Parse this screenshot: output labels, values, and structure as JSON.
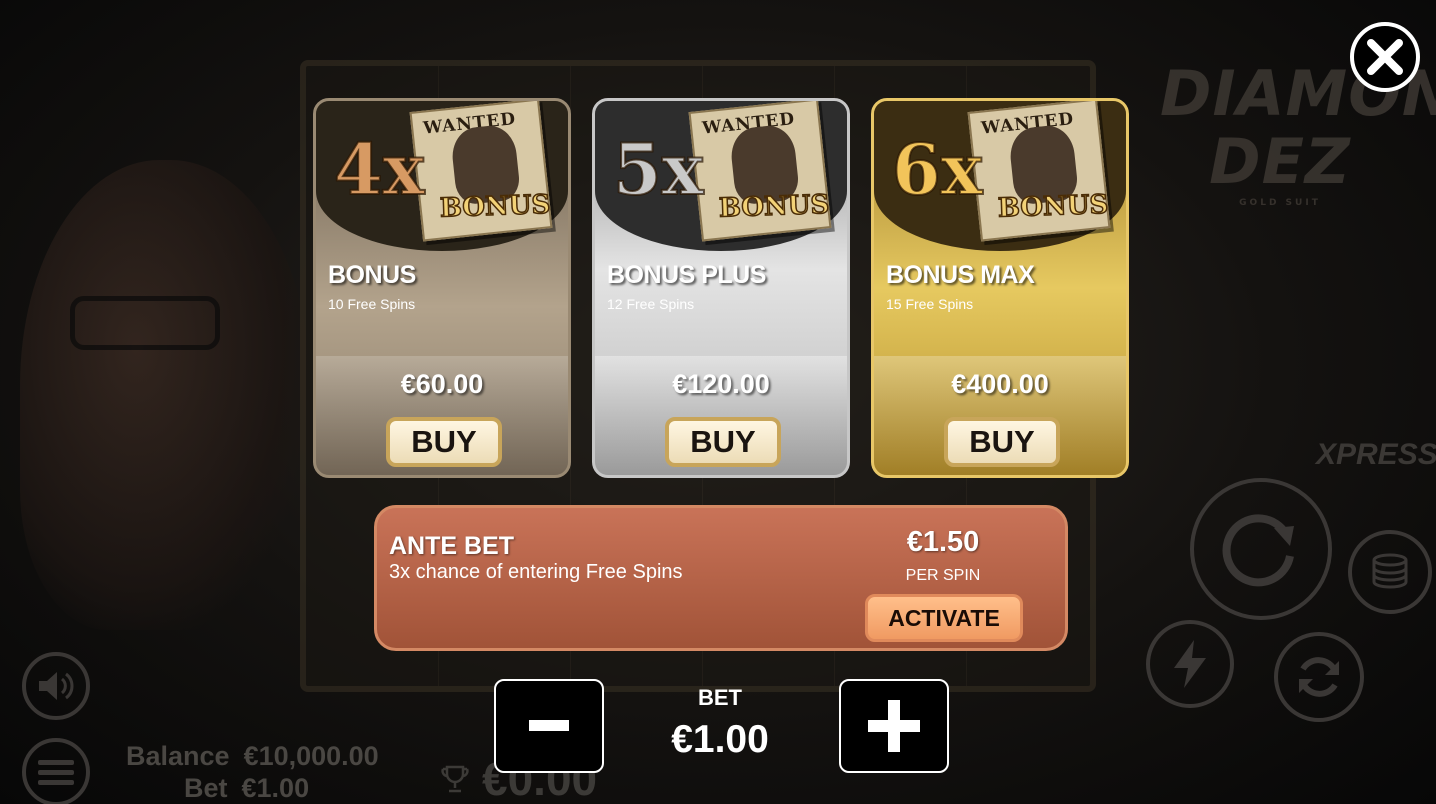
{
  "game": {
    "logo_line1": "DIAMOND",
    "logo_line2": "DEZ",
    "logo_sub": "GOLD SUIT",
    "xpress_label": "XPRESS"
  },
  "footer": {
    "balance_label": "Balance",
    "balance_value": "€10,000.00",
    "bet_label": "Bet",
    "bet_value": "€1.00",
    "win_value": "€0.00"
  },
  "bonus_cards": [
    {
      "multiplier": "4x",
      "poster_wanted": "WANTED",
      "poster_badge": "BONUS",
      "name": "BONUS",
      "spins": "10 Free Spins",
      "price": "€60.00",
      "buy_label": "BUY"
    },
    {
      "multiplier": "5x",
      "poster_wanted": "WANTED",
      "poster_badge": "BONUS",
      "name": "BONUS PLUS",
      "spins": "12 Free Spins",
      "price": "€120.00",
      "buy_label": "BUY"
    },
    {
      "multiplier": "6x",
      "poster_wanted": "WANTED",
      "poster_badge": "BONUS",
      "name": "BONUS MAX",
      "spins": "15 Free Spins",
      "price": "€400.00",
      "buy_label": "BUY"
    }
  ],
  "ante_bet": {
    "title": "ANTE BET",
    "description": "3x chance of entering Free Spins",
    "cost": "€1.50",
    "per_spin": "PER SPIN",
    "activate_label": "ACTIVATE"
  },
  "bet_control": {
    "label": "BET",
    "value": "€1.00",
    "decrease_symbol": "-",
    "increase_symbol": "+"
  },
  "icons": [
    "close-icon",
    "minus-icon",
    "plus-icon",
    "sound-icon",
    "menu-icon",
    "trophy-icon",
    "spin-icon",
    "coins-icon",
    "lightning-icon",
    "autoplay-icon"
  ],
  "colors": {
    "bronze": "#b3a38c",
    "silver": "#e4e4e4",
    "gold": "#e6c960",
    "ante": "#b8644a",
    "buy_button": "#f5e8c8",
    "activate_button": "#f5a66e"
  }
}
